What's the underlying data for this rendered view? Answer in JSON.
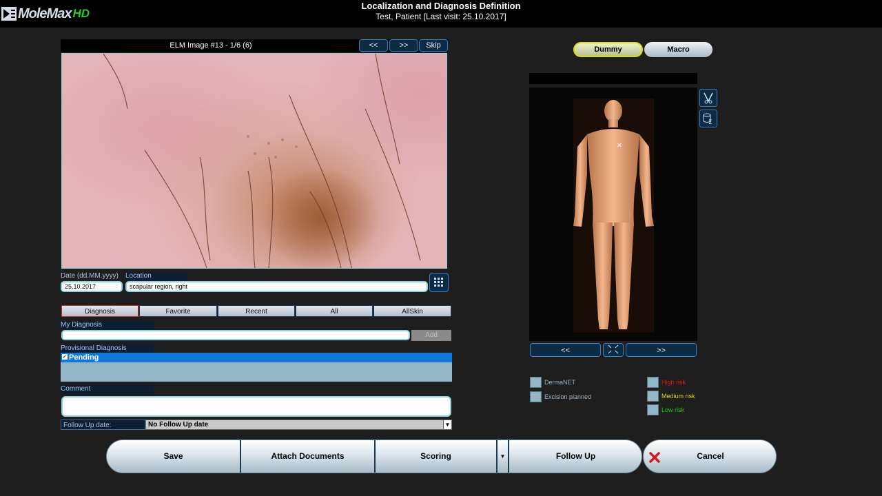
{
  "app": {
    "logo_text": "MoleMax",
    "logo_hd": "HD"
  },
  "header": {
    "title": "Localization and Diagnosis Definition",
    "subtitle": "Test, Patient [Last visit: 25.10.2017]"
  },
  "image_panel": {
    "caption": "ELM Image #13 - 1/6 (6)",
    "prev_label": "<<",
    "next_label": ">>",
    "skip_label": "Skip"
  },
  "fields": {
    "date_label": "Date (dd.MM.yyyy)",
    "date_value": "25.10.2017",
    "location_label": "Location",
    "location_value": "scapular region, right"
  },
  "tabs": [
    {
      "label": "Diagnosis"
    },
    {
      "label": "Favorite"
    },
    {
      "label": "Recent"
    },
    {
      "label": "All"
    },
    {
      "label": "AllSkin"
    }
  ],
  "my_diagnosis": {
    "label": "My Diagnosis",
    "value": "",
    "add_label": "Add"
  },
  "provisional_diagnosis": {
    "label": "Provisional Diagnosis",
    "items": [
      {
        "label": "Pending",
        "checked": true
      }
    ]
  },
  "comment": {
    "label": "Comment",
    "value": ""
  },
  "follow_up": {
    "label": "Follow Up date:",
    "selected": "No Follow Up date"
  },
  "view_toggle": {
    "dummy_label": "Dummy",
    "macro_label": "Macro",
    "active": "Dummy"
  },
  "body_map": {
    "prev_label": "<<",
    "next_label": ">>",
    "marker": "×"
  },
  "flags": {
    "left": [
      {
        "label": "DermaNET"
      },
      {
        "label": "Excision planned"
      }
    ],
    "right": [
      {
        "label": "High risk",
        "color": "#e01818"
      },
      {
        "label": "Medium risk",
        "color": "#e0d818"
      },
      {
        "label": "Low risk",
        "color": "#20d020"
      }
    ]
  },
  "actions": {
    "save_label": "Save",
    "attach_label": "Attach Documents",
    "scoring_label": "Scoring",
    "follow_up_label": "Follow Up",
    "cancel_label": "Cancel"
  },
  "colors": {
    "accent_blue": "#3c7cc0",
    "selection": "#1177d6",
    "logo_green": "#19d31b"
  }
}
